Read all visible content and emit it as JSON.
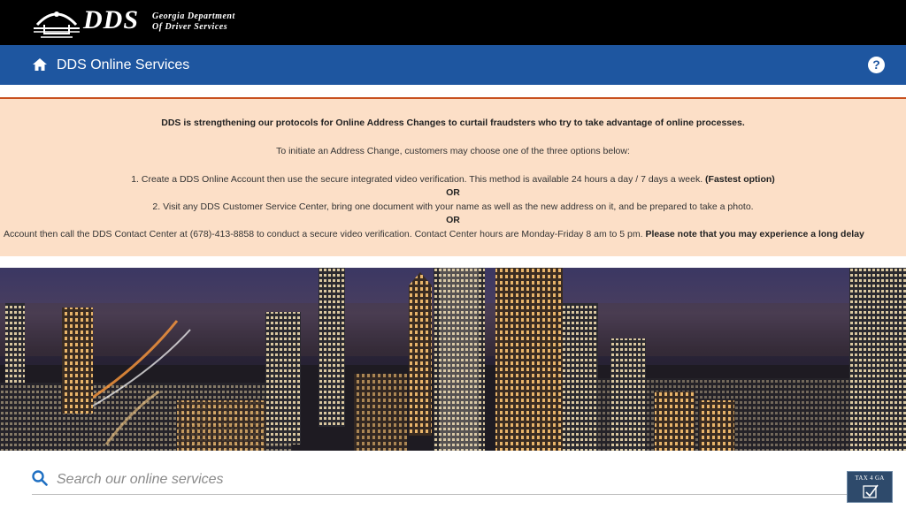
{
  "brand": {
    "logo_text": "DDS",
    "org_line1": "Georgia Department",
    "org_line2": "Of Driver Services"
  },
  "nav": {
    "title": "DDS Online Services",
    "help_glyph": "?",
    "icons": [
      "home-icon",
      "help-icon"
    ]
  },
  "alert": {
    "headline": "DDS is strengthening our protocols for Online Address Changes to curtail fraudsters who try to take advantage of online processes.",
    "intro": "To initiate an Address Change, customers may choose one of the three options below:",
    "option1": "1. Create a DDS Online Account then use the secure integrated video verification. This method is available 24 hours a day / 7 days a week.",
    "option1_emphasis": "(Fastest option)",
    "or1": "OR",
    "option2": "2. Visit any DDS Customer Service Center, bring one document with your name as well as the new address on it, and be prepared to take a photo.",
    "or2": "OR",
    "option3": "Account then call the DDS Contact Center at (678)-413-8858 to conduct a secure video verification. Contact Center hours are Monday-Friday 8 am to 5 pm.",
    "option3_emphasis": "Please note that you may experience a long delay"
  },
  "search": {
    "placeholder": "Search our online services"
  },
  "badge": {
    "text": "TAX 4 GA"
  },
  "colors": {
    "nav_blue": "#1e56a0",
    "alert_bg": "#fcdfc7",
    "alert_border": "#c8501e",
    "search_icon": "#1e6fc2"
  }
}
